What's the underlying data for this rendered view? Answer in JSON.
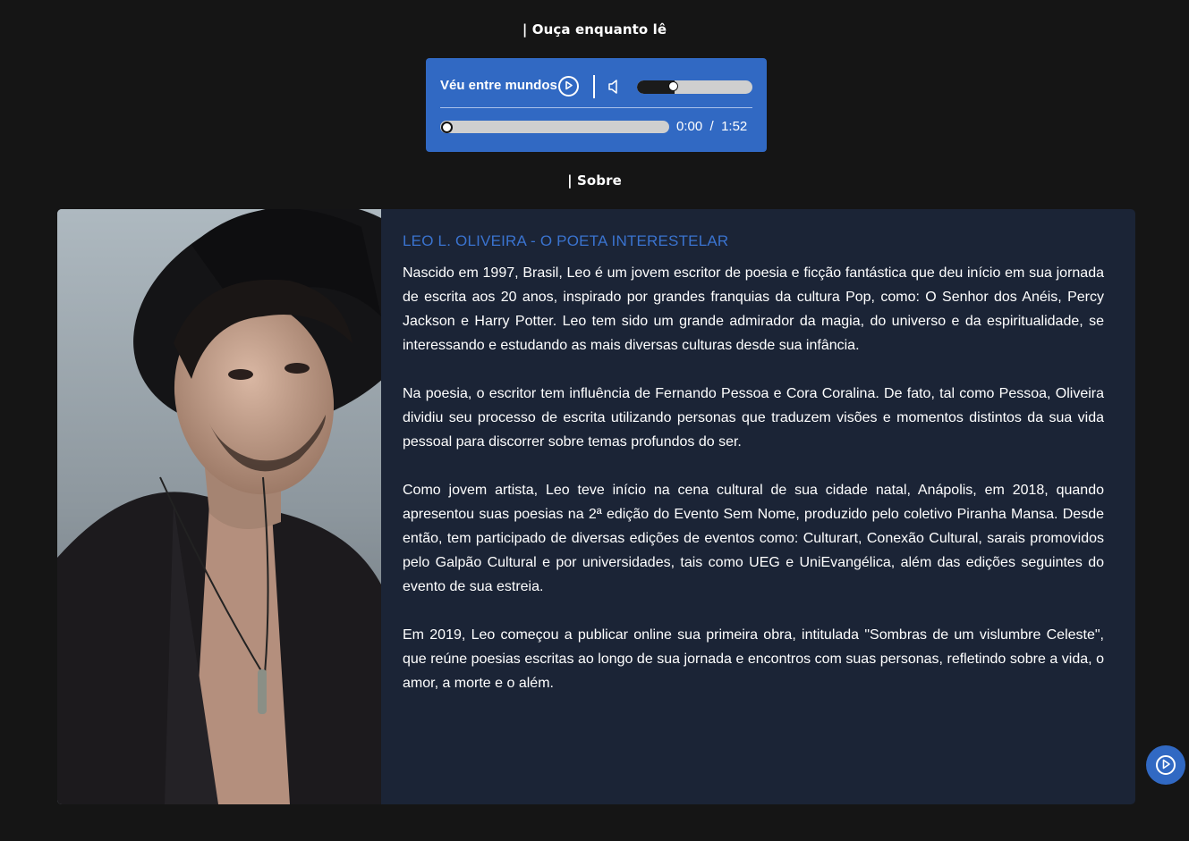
{
  "sections": {
    "listen_label": "| Ouça enquanto lê",
    "about_label": "| Sobre"
  },
  "player": {
    "track_title": "Véu entre mundos",
    "current_time": "0:00",
    "separator": "/",
    "duration": "1:52",
    "volume_level": 0.28,
    "progress": 0.0,
    "play_icon": "play-circle-icon",
    "volume_icon": "speaker-volume-icon",
    "accent_color": "#3169c3"
  },
  "about": {
    "heading": "LEO L. OLIVEIRA - O POETA INTERESTELAR",
    "paragraphs": [
      "Nascido em 1997, Brasil, Leo é um jovem escritor de poesia e ficção fantástica que deu início em sua jornada de escrita aos 20 anos, inspirado por grandes franquias da cultura Pop, como: O Senhor dos Anéis, Percy Jackson e Harry Potter. Leo tem sido um grande admirador da magia, do universo e da espiritualidade, se interessando e estudando as mais diversas culturas desde sua infância.",
      "Na poesia, o escritor tem influência de Fernando Pessoa e Cora Coralina. De fato, tal como Pessoa, Oliveira dividiu seu processo de escrita utilizando personas que traduzem visões e momentos distintos da sua vida pessoal para discorrer sobre temas profundos do ser.",
      "Como jovem artista, Leo teve início na cena cultural de sua cidade natal, Anápolis, em 2018, quando apresentou suas poesias na 2ª edição do Evento Sem Nome, produzido pelo coletivo Piranha Mansa. Desde então, tem participado de diversas edições de eventos como: Culturart, Conexão Cultural, sarais promovidos pelo Galpão Cultural e por universidades, tais como UEG e UniEvangélica, além das edições seguintes do evento de sua estreia.",
      "Em 2019, Leo começou a publicar online sua primeira obra, intitulada \"Sombras de um vislumbre Celeste\", que reúne poesias escritas ao longo de sua jornada e encontros com suas personas, refletindo sobre a vida, o amor, a morte e o além."
    ],
    "heading_color": "#3a73cf",
    "card_color": "#1b2436"
  },
  "floating_button": {
    "icon": "play-circle-icon"
  }
}
